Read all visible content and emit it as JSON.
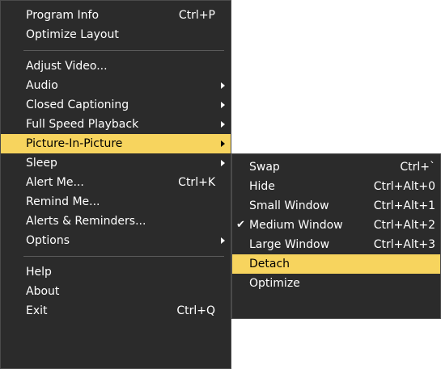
{
  "main_menu": {
    "items": [
      {
        "label": "Program Info",
        "shortcut": "Ctrl+P"
      },
      {
        "label": "Optimize Layout"
      },
      {
        "label": "Adjust Video..."
      },
      {
        "label": "Audio"
      },
      {
        "label": "Closed Captioning"
      },
      {
        "label": "Full Speed Playback"
      },
      {
        "label": "Picture-In-Picture"
      },
      {
        "label": "Sleep"
      },
      {
        "label": "Alert Me...",
        "shortcut": "Ctrl+K"
      },
      {
        "label": "Remind Me..."
      },
      {
        "label": "Alerts & Reminders..."
      },
      {
        "label": "Options"
      },
      {
        "label": "Help"
      },
      {
        "label": "About"
      },
      {
        "label": "Exit",
        "shortcut": "Ctrl+Q"
      }
    ]
  },
  "pip_submenu": {
    "items": [
      {
        "label": "Swap",
        "shortcut": "Ctrl+`"
      },
      {
        "label": "Hide",
        "shortcut": "Ctrl+Alt+0"
      },
      {
        "label": "Small Window",
        "shortcut": "Ctrl+Alt+1"
      },
      {
        "label": "Medium Window",
        "shortcut": "Ctrl+Alt+2",
        "checked": true,
        "check_glyph": "✔"
      },
      {
        "label": "Large Window",
        "shortcut": "Ctrl+Alt+3"
      },
      {
        "label": "Detach"
      },
      {
        "label": "Optimize"
      }
    ]
  },
  "colors": {
    "menu_background": "#2b2b2b",
    "highlight": "#f7d45e",
    "text": "#ffffff",
    "highlight_text": "#000000"
  },
  "icons": {
    "submenu_arrow": "chevron-right-icon",
    "check": "checkmark-icon"
  }
}
